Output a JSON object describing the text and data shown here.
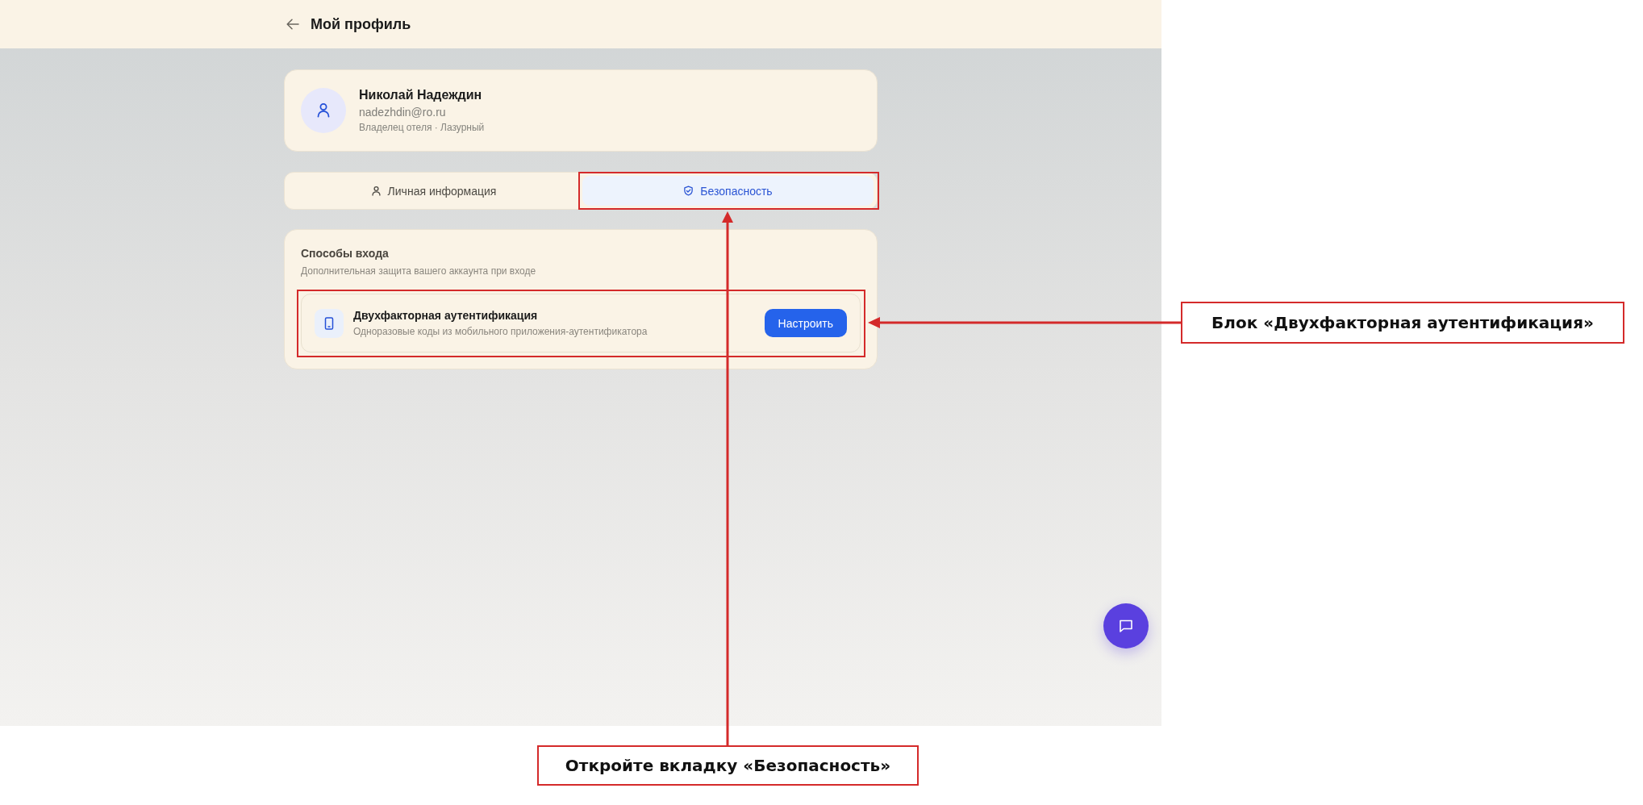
{
  "header": {
    "title": "Мой профиль"
  },
  "profile": {
    "name": "Николай Надеждин",
    "email": "nadezhdin@ro.ru",
    "role": "Владелец отеля · Лазурный"
  },
  "tabs": [
    {
      "label": "Личная информация",
      "selected": false,
      "highlighted": false
    },
    {
      "label": "Безопасность",
      "selected": true,
      "highlighted": true
    }
  ],
  "login_methods": {
    "title": "Способы входа",
    "subtitle": "Дополнительная защита вашего аккаунта при входе",
    "items": [
      {
        "title": "Двухфакторная аутентификация",
        "description": "Одноразовые коды из мобильного приложения-аутентификатора",
        "button": "Настроить",
        "highlighted": true
      }
    ]
  },
  "annotations": [
    {
      "text": "Блок «Двухфакторная аутентификация»"
    },
    {
      "text": "Откройте вкладку «Безопасность»"
    }
  ]
}
